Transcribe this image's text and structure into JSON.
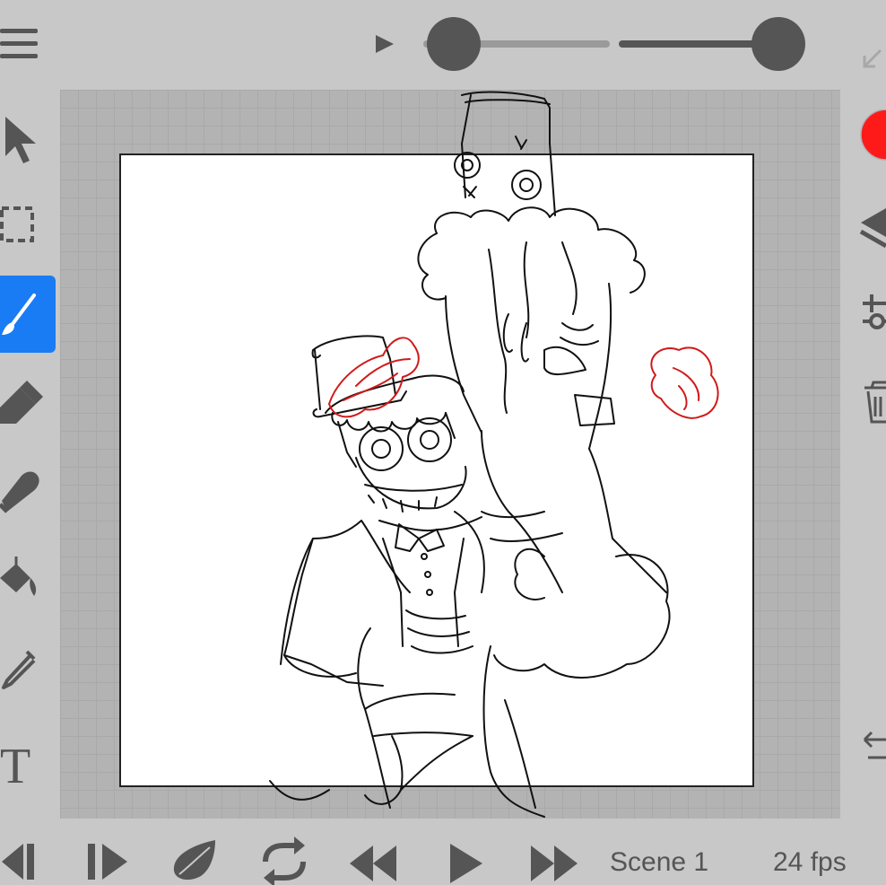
{
  "colors": {
    "background": "#c8c8c8",
    "icon": "#555555",
    "accent": "#1a7cf5",
    "current_color": "#ff1a1a",
    "stroke": "#111111",
    "sketch_red": "#d11a1a"
  },
  "top_bar": {
    "menu_icon": "hamburger-icon",
    "play_icon": "play-icon",
    "opacity_slider": {
      "value": 0.0
    },
    "brush_size_slider": {
      "value": 1.0
    },
    "collapse_icon": "arrow-down-left-icon"
  },
  "left_toolbar": {
    "tools": [
      {
        "name": "select",
        "icon": "pointer-icon",
        "active": false
      },
      {
        "name": "marquee",
        "icon": "marquee-icon",
        "active": false
      },
      {
        "name": "brush",
        "icon": "brush-icon",
        "active": true
      },
      {
        "name": "eraser",
        "icon": "eraser-icon",
        "active": false
      },
      {
        "name": "smudge",
        "icon": "smudge-icon",
        "active": false
      },
      {
        "name": "fill",
        "icon": "paint-bucket-icon",
        "active": false
      },
      {
        "name": "eyedropper",
        "icon": "eyedropper-icon",
        "active": false
      },
      {
        "name": "text",
        "icon": "text-icon",
        "label": "T",
        "active": false
      }
    ]
  },
  "right_toolbar": {
    "color_swatch": "#ff1a1a",
    "tools": [
      "layers-icon",
      "settings-sliders-icon",
      "trash-icon",
      "swap-arrows-icon"
    ]
  },
  "bottom_bar": {
    "controls": [
      "previous-frame-icon",
      "next-frame-icon",
      "onion-skin-icon",
      "loop-icon",
      "rewind-icon",
      "play-icon",
      "fast-forward-icon"
    ],
    "scene_label": "Scene 1",
    "fps_label": "24 fps"
  }
}
